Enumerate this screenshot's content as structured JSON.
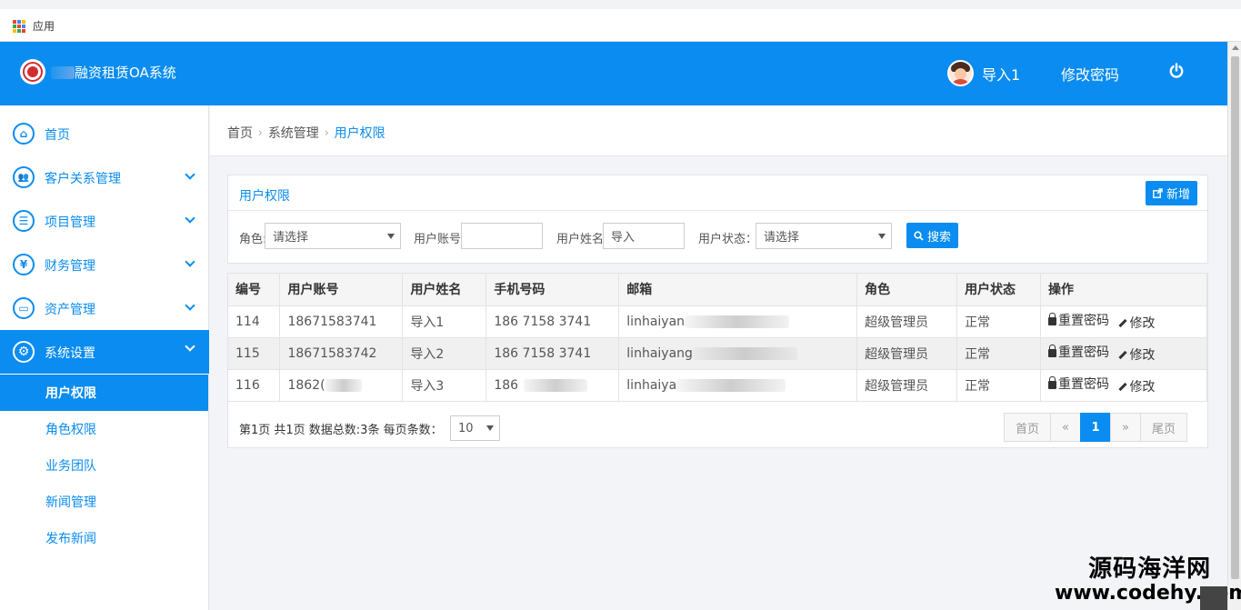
{
  "browser": {
    "bookmark_label": "应用"
  },
  "header": {
    "system_title": "融资租赁OA系统",
    "user_name": "导入1",
    "change_password": "修改密码",
    "colors": {
      "primary": "#0a8cf0"
    }
  },
  "sidebar": {
    "menu": [
      {
        "label": "首页",
        "icon": "home-icon",
        "icon_glyph": "⌂"
      },
      {
        "label": "客户关系管理",
        "icon": "users-icon",
        "icon_glyph": "👥"
      },
      {
        "label": "项目管理",
        "icon": "list-icon",
        "icon_glyph": "☰"
      },
      {
        "label": "财务管理",
        "icon": "yen-icon",
        "icon_glyph": "¥"
      },
      {
        "label": "资产管理",
        "icon": "document-icon",
        "icon_glyph": "▭"
      },
      {
        "label": "系统设置",
        "icon": "gear-icon",
        "icon_glyph": "⚙"
      }
    ],
    "submenu": [
      {
        "label": "用户权限",
        "active": true
      },
      {
        "label": "角色权限"
      },
      {
        "label": "业务团队"
      },
      {
        "label": "新闻管理"
      },
      {
        "label": "发布新闻"
      }
    ]
  },
  "breadcrumb": {
    "items": [
      "首页",
      "系统管理"
    ],
    "current": "用户权限"
  },
  "panel": {
    "title": "用户权限",
    "add_button": "新增",
    "filters": {
      "role_label": "角色:",
      "role_value": "请选择",
      "account_label": "用户账号:",
      "account_value": "",
      "name_label": "用户姓名:",
      "name_value": "导入",
      "status_label": "用户状态：",
      "status_value": "请选择",
      "search_button": "搜索"
    }
  },
  "table": {
    "headers": [
      "编号",
      "用户账号",
      "用户姓名",
      "手机号码",
      "邮箱",
      "角色",
      "用户状态",
      "操作"
    ],
    "rows": [
      {
        "id": "114",
        "account": "18671583741",
        "name": "导入1",
        "phone": "186 7158 3741",
        "email": "linhaiyan",
        "role": "超级管理员",
        "status": "正常"
      },
      {
        "id": "115",
        "account": "18671583742",
        "name": "导入2",
        "phone": "186 7158 3741",
        "email": "linhaiyang",
        "role": "超级管理员",
        "status": "正常"
      },
      {
        "id": "116",
        "account": "1862(",
        "name": "导入3",
        "phone": "186",
        "email": "linhaiya",
        "role": "超级管理员",
        "status": "正常"
      }
    ],
    "ops": {
      "reset": "重置密码",
      "edit": "修改"
    }
  },
  "pager": {
    "info": "第1页 共1页 数据总数:3条 每页条数：",
    "page_size": "10",
    "first": "首页",
    "prev": "«",
    "current": "1",
    "next": "»",
    "last": "尾页"
  },
  "watermark": {
    "line1": "源码海洋网",
    "line2": "www.codehy.com"
  }
}
